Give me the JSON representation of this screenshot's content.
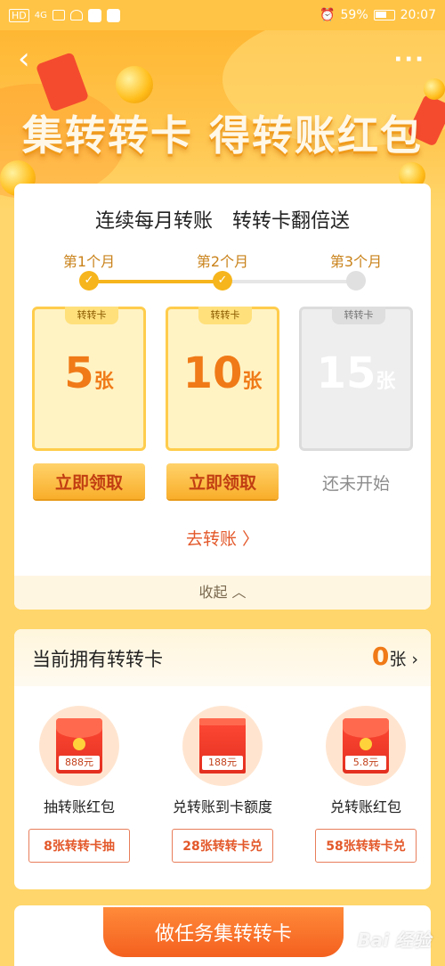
{
  "status_bar": {
    "network": "HD",
    "signal": "4G",
    "battery_percent": "59%",
    "time": "20:07"
  },
  "hero": {
    "title": "集转转卡 得转账红包",
    "back_icon": "chevron-left-icon",
    "more_icon": "more-dots-icon"
  },
  "progress_card": {
    "title": "连续每月转账　转转卡翻倍送",
    "months": [
      {
        "label": "第1个月",
        "done": true
      },
      {
        "label": "第2个月",
        "done": true
      },
      {
        "label": "第3个月",
        "done": false
      }
    ],
    "rewards": [
      {
        "tag": "转转卡",
        "count": "5",
        "unit": "张",
        "action": "立即领取"
      },
      {
        "tag": "转转卡",
        "count": "10",
        "unit": "张",
        "action": "立即领取"
      },
      {
        "tag": "转转卡",
        "count": "15",
        "unit": "张",
        "action": "还未开始"
      }
    ],
    "go_transfer": "去转账 〉",
    "collapse": "收起 ︿"
  },
  "owned_card": {
    "label": "当前拥有转转卡",
    "count": "0",
    "unit": "张",
    "items": [
      {
        "price": "888元",
        "name": "抽转账红包",
        "button": "8张转转卡抽"
      },
      {
        "price": "188元",
        "name": "兑转账到卡额度",
        "button": "28张转转卡兑"
      },
      {
        "price": "5.8元",
        "name": "兑转账红包",
        "button": "58张转转卡兑"
      }
    ]
  },
  "task_button": "做任务集转转卡",
  "watermark": "Bai 经验",
  "colors": {
    "accent": "#f07a17",
    "primary_bg": "#ffd66b",
    "button_red": "#e3582a"
  }
}
